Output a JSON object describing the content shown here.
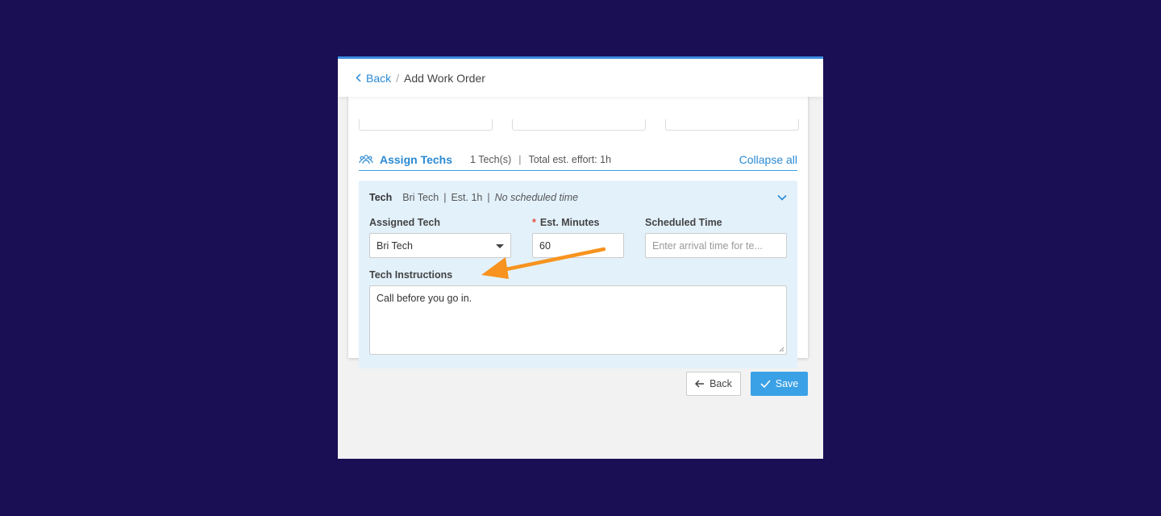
{
  "header": {
    "back_label": "Back",
    "separator": "/",
    "current": "Add Work Order"
  },
  "assign_section": {
    "title": "Assign Techs",
    "tech_count": "1 Tech(s)",
    "separator": "|",
    "total_effort": "Total est. effort: 1h",
    "collapse_label": "Collapse all"
  },
  "tech_entry": {
    "label": "Tech",
    "name": "Bri Tech",
    "sep": "|",
    "estimate": "Est. 1h",
    "schedule": "No scheduled time",
    "assigned_tech_label": "Assigned Tech",
    "assigned_tech_value": "Bri Tech",
    "est_minutes_required": "*",
    "est_minutes_label": "Est. Minutes",
    "est_minutes_value": "60",
    "scheduled_time_label": "Scheduled Time",
    "scheduled_time_placeholder": "Enter arrival time for te...",
    "instructions_label": "Tech Instructions",
    "instructions_value": "Call before you go in."
  },
  "footer": {
    "back_label": "Back",
    "save_label": "Save"
  },
  "colors": {
    "page_background": "#1a0f54",
    "accent": "#3aa1e6",
    "link": "#2a8ad4",
    "panel": "#e3f1fb",
    "arrow": "#f7931e"
  }
}
